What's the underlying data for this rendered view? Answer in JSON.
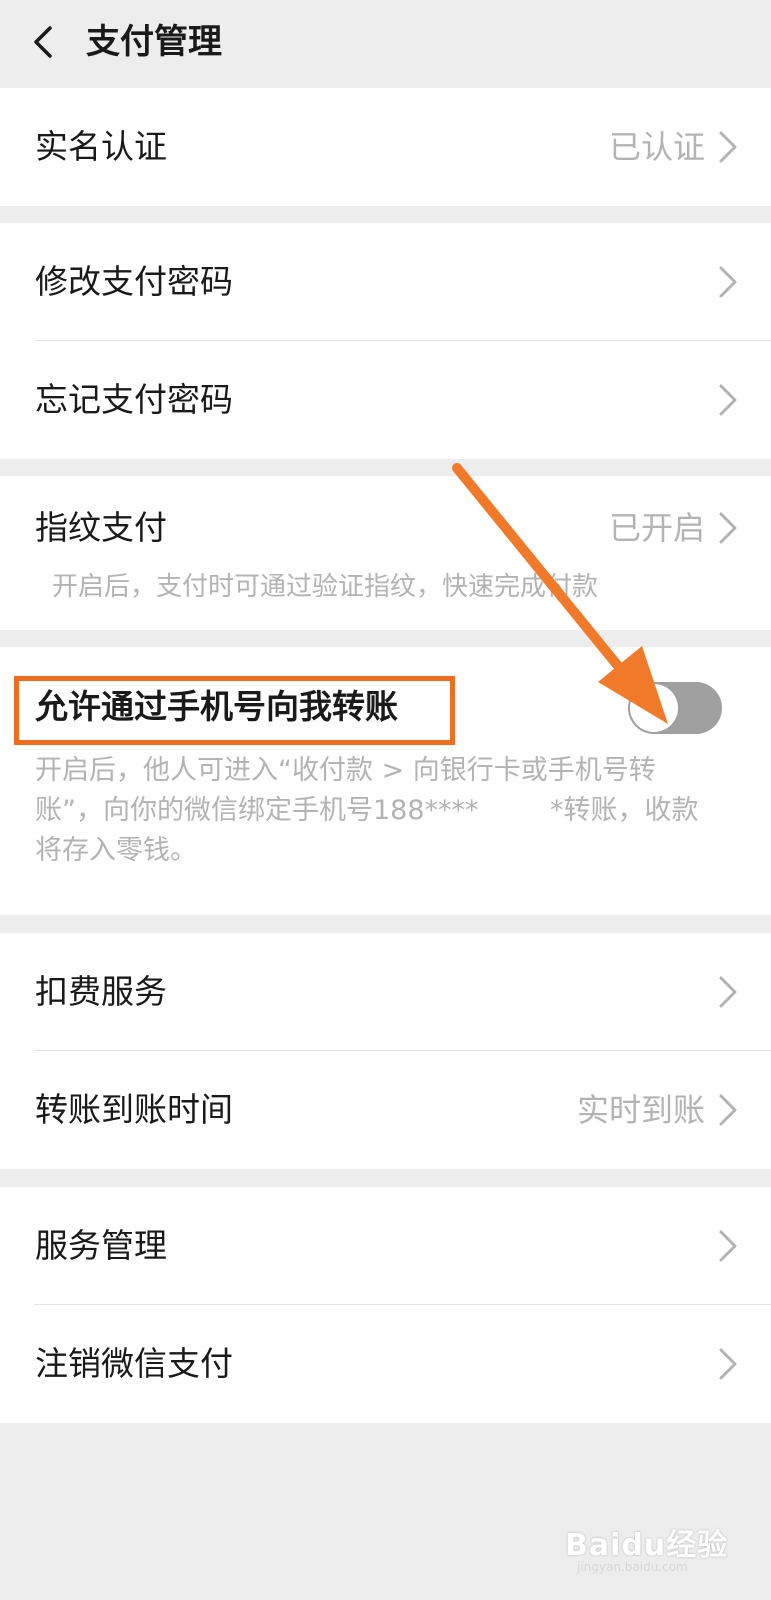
{
  "header": {
    "title": "支付管理"
  },
  "rows": {
    "real_name": {
      "label": "实名认证",
      "value": "已认证"
    },
    "change_pwd": {
      "label": "修改支付密码"
    },
    "forget_pwd": {
      "label": "忘记支付密码"
    },
    "fingerprint": {
      "label": "指纹支付",
      "value": "已开启",
      "desc": "开启后，支付时可通过验证指纹，快速完成付款"
    },
    "phone_transfer": {
      "label": "允许通过手机号向我转账",
      "toggle_on": false,
      "desc_line1": "开启后，他人可进入“收付款 > 向银行卡或手机号转",
      "desc_line2a": "账”，向你的微信绑定手机号188****",
      "desc_line2b": "*转账，收款",
      "desc_line3": "将存入零钱。"
    },
    "deduct": {
      "label": "扣费服务"
    },
    "arrival_time": {
      "label": "转账到账时间",
      "value": "实时到账"
    },
    "service_mgmt": {
      "label": "服务管理"
    },
    "cancel_pay": {
      "label": "注销微信支付"
    }
  },
  "watermark": {
    "text": "Baidu经验",
    "sub": "jingyan.baidu.com"
  },
  "colors": {
    "background": "#ededed",
    "annotation": "#f06d1e",
    "toggle_off": "#a0a0a0",
    "secondary_text": "#b3b3b3"
  }
}
